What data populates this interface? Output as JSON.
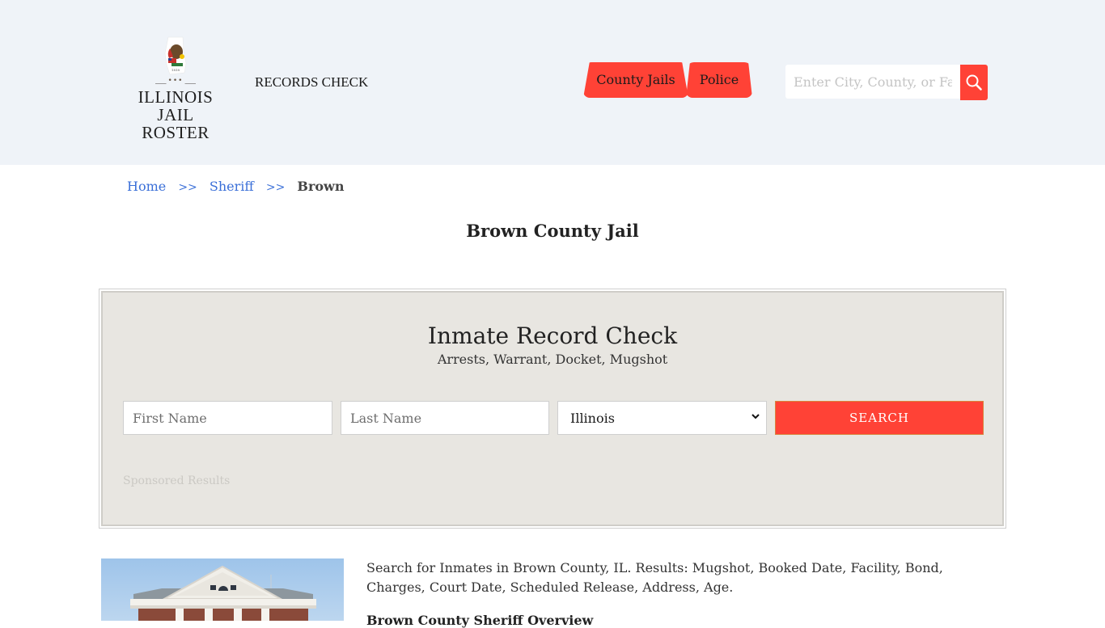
{
  "header": {
    "logo": {
      "line1": "ILLINOIS",
      "line2": "JAIL ROSTER"
    },
    "records_check": "RECORDS CHECK",
    "nav_tabs": [
      {
        "label": "County Jails"
      },
      {
        "label": "Police"
      }
    ],
    "search": {
      "placeholder": "Enter City, County, or Facility",
      "value": ""
    }
  },
  "breadcrumb": {
    "items": [
      {
        "label": "Home"
      },
      {
        "label": "Sheriff"
      },
      {
        "label": "Brown"
      }
    ],
    "separator": ">>"
  },
  "page_title": "Brown County Jail",
  "record_check": {
    "title": "Inmate Record Check",
    "subtitle": "Arrests, Warrant, Docket, Mugshot",
    "first_name_placeholder": "First Name",
    "last_name_placeholder": "Last Name",
    "state_selected": "Illinois",
    "search_label": "SEARCH",
    "sponsored_label": "Sponsored Results"
  },
  "content": {
    "intro": "Search for Inmates in Brown County, IL. Results: Mugshot, Booked Date, Facility, Bond, Charges, Court Date, Scheduled Release, Address, Age.",
    "next_heading": "Brown County Sheriff Overview"
  },
  "colors": {
    "accent": "#ff4236",
    "header_bg": "#eff3f8",
    "panel_bg": "#e8e6e1",
    "link": "#3a6fd8"
  }
}
